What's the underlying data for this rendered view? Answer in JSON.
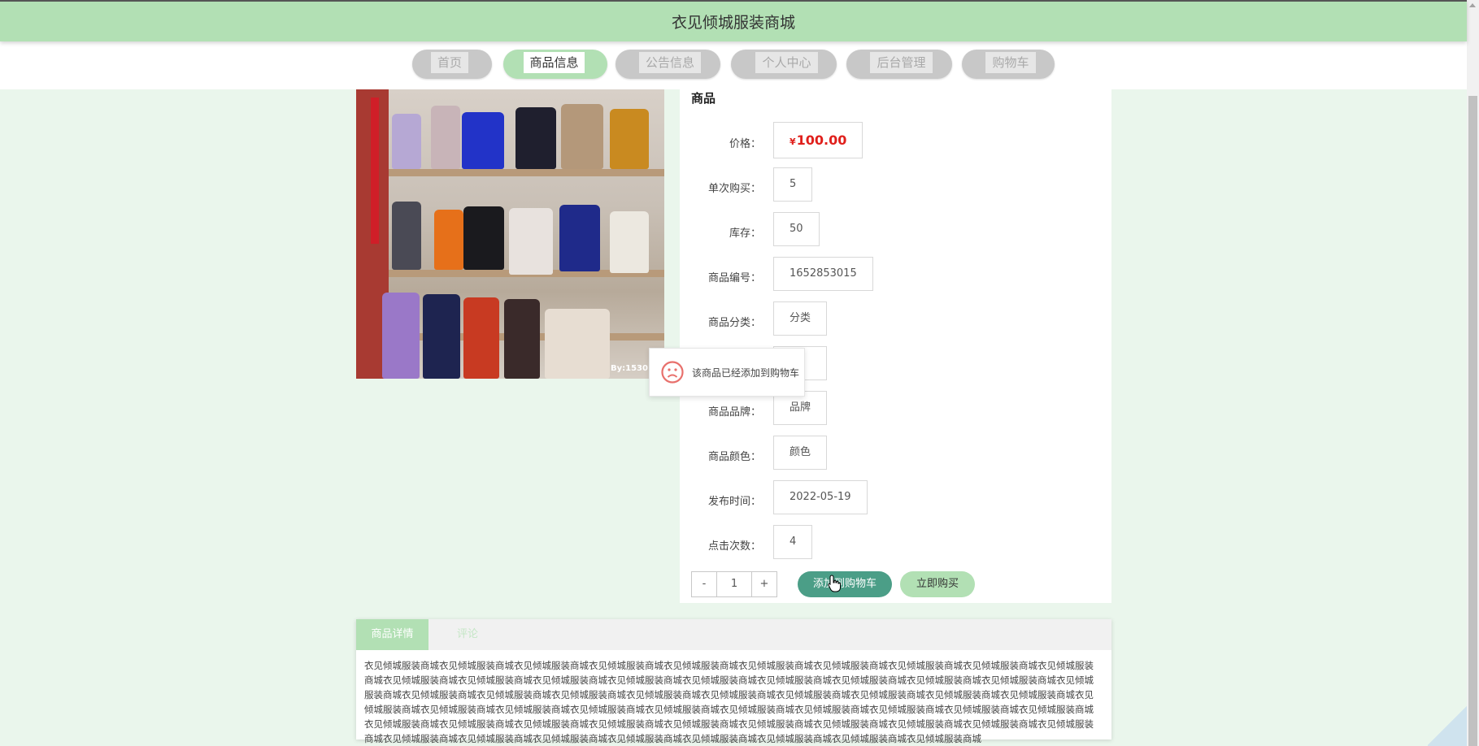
{
  "header": {
    "title": "衣见倾城服装商城"
  },
  "nav": {
    "items": [
      {
        "label": "首页"
      },
      {
        "label": "商品信息"
      },
      {
        "label": "公告信息"
      },
      {
        "label": "个人中心"
      },
      {
        "label": "后台管理"
      },
      {
        "label": "购物车"
      }
    ],
    "active": "商品信息"
  },
  "product": {
    "image": {
      "watermark": "By:15301"
    },
    "title": "商品",
    "price_symbol": "¥",
    "fields": [
      {
        "label": "价格：",
        "value": "100.00"
      },
      {
        "label": "单次购买：",
        "value": "5"
      },
      {
        "label": "库存：",
        "value": "50"
      },
      {
        "label": "商品编号：",
        "value": "1652853015"
      },
      {
        "label": "商品分类：",
        "value": "分类"
      },
      {
        "label": "商品品牌：",
        "value": "品牌"
      },
      {
        "label": "商品颜色：",
        "value": "颜色"
      },
      {
        "label": "发布时间：",
        "value": "2022-05-19"
      },
      {
        "label": "点击次数：",
        "value": "4"
      }
    ],
    "quantity": {
      "minus": "-",
      "value": "1",
      "plus": "+"
    },
    "add_to_cart_label": "添加到购物车",
    "buy_now_label": "立即购买"
  },
  "toast": {
    "message": "该商品已经添加到购物车"
  },
  "detail": {
    "tabs": [
      {
        "label": "商品详情"
      },
      {
        "label": "评论"
      }
    ],
    "active_tab": "商品详情",
    "content": "衣见倾城服装商城衣见倾城服装商城衣见倾城服装商城衣见倾城服装商城衣见倾城服装商城衣见倾城服装商城衣见倾城服装商城衣见倾城服装商城衣见倾城服装商城衣见倾城服装商城衣见倾城服装商城衣见倾城服装商城衣见倾城服装商城衣见倾城服装商城衣见倾城服装商城衣见倾城服装商城衣见倾城服装商城衣见倾城服装商城衣见倾城服装商城衣见倾城服装商城衣见倾城服装商城衣见倾城服装商城衣见倾城服装商城衣见倾城服装商城衣见倾城服装商城衣见倾城服装商城衣见倾城服装商城衣见倾城服装商城衣见倾城服装商城衣见倾城服装商城衣见倾城服装商城衣见倾城服装商城衣见倾城服装商城衣见倾城服装商城衣见倾城服装商城衣见倾城服装商城衣见倾城服装商城衣见倾城服装商城衣见倾城服装商城衣见倾城服装商城衣见倾城服装商城衣见倾城服装商城衣见倾城服装商城衣见倾城服装商城衣见倾城服装商城衣见倾城服装商城衣见倾城服装商城衣见倾城服装商城衣见倾城服装商城衣见倾城服装商城衣见倾城服装商城衣见倾城服装商城衣见倾城服装商城衣见倾城服装商城衣见倾城服装商城衣见倾城服装商城衣见倾城服装商城"
  },
  "colors": {
    "primary": "#b2e0b4",
    "accent": "#4b9e87",
    "price": "#e0201c",
    "page_bg": "#eaf6ec"
  }
}
